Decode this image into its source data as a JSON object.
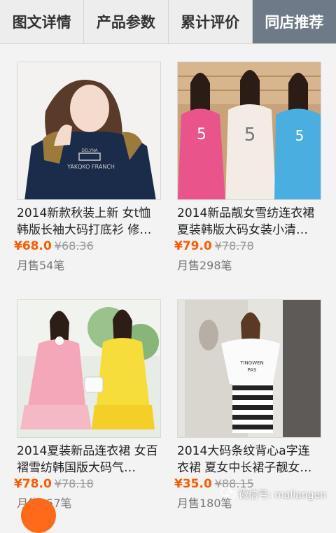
{
  "tabs": [
    {
      "label": "图文详情",
      "active": false
    },
    {
      "label": "产品参数",
      "active": false
    },
    {
      "label": "累计评价",
      "active": false
    },
    {
      "label": "同店推荐",
      "active": true
    }
  ],
  "products": [
    {
      "title": "2014新款秋装上新 女t恤韩版长袖大码打底衫 修…",
      "price": "¥68.0",
      "original_price": "¥68.36",
      "sales": "月售54笔",
      "image_text": "DELYNA YAKQKO FRANCH"
    },
    {
      "title": "2014新品靓女雪纺连衣裙夏装韩版大码女装小清…",
      "price": "¥79.0",
      "original_price": "¥78.78",
      "sales": "月售298笔",
      "image_text": "5"
    },
    {
      "title": "2014夏装新品连衣裙 女百褶雪纺韩国版大码气…",
      "price": "¥78.0",
      "original_price": "¥78.18",
      "sales": "月售657笔",
      "image_text": ""
    },
    {
      "title": "2014大码条纹背心a字连衣裙 夏女中长裙子靓女…",
      "price": "¥35.0",
      "original_price": "¥88.15",
      "sales": "月售180笔",
      "image_text": "TINGWEN PAS"
    }
  ],
  "watermark": "微信号: mallangen",
  "colors": {
    "accent": "#ff5a00",
    "active_tab": "#6e7a87"
  }
}
